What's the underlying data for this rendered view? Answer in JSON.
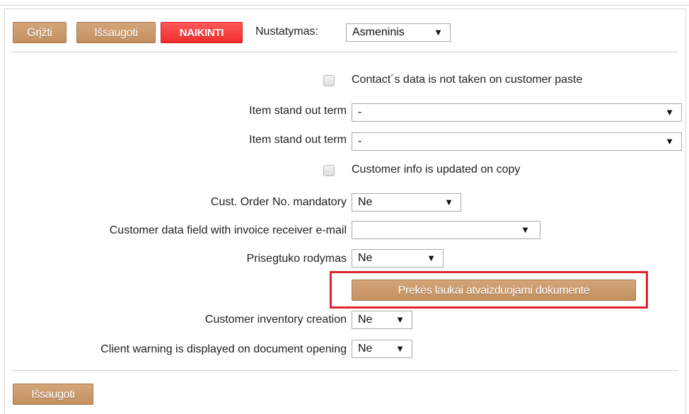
{
  "toolbar": {
    "back_label": "Grįžti",
    "save_label": "Išsaugoti",
    "delete_label": "NAIKINTI",
    "setting_label": "Nustatymas:",
    "setting_value": "Asmeninis"
  },
  "settings": {
    "contact_data_checkbox": "Contact´s data is not taken on customer paste",
    "item_stand_out_1_label": "Item stand out term",
    "item_stand_out_1_value": "-",
    "item_stand_out_2_label": "Item stand out term",
    "item_stand_out_2_value": "-",
    "customer_info_checkbox": "Customer info is updated on copy",
    "cust_order_label": "Cust. Order No. mandatory",
    "cust_order_value": "Ne",
    "invoice_email_label": "Customer data field with invoice receiver e-mail",
    "invoice_email_value": "",
    "attachment_label": "Prisegtuko rodymas",
    "attachment_value": "Ne",
    "item_fields_button": "Prekės laukai atvaizduojami dokumente",
    "inventory_label": "Customer inventory creation",
    "inventory_value": "Ne",
    "client_warning_label": "Client warning is displayed on document opening",
    "client_warning_value": "Ne"
  },
  "footer": {
    "save_label": "Išsaugoti"
  },
  "icons": {
    "dropdown_arrow": "▼"
  },
  "colors": {
    "button": "#c8966a",
    "delete": "#f43a3a",
    "highlight": "#e0232d"
  }
}
